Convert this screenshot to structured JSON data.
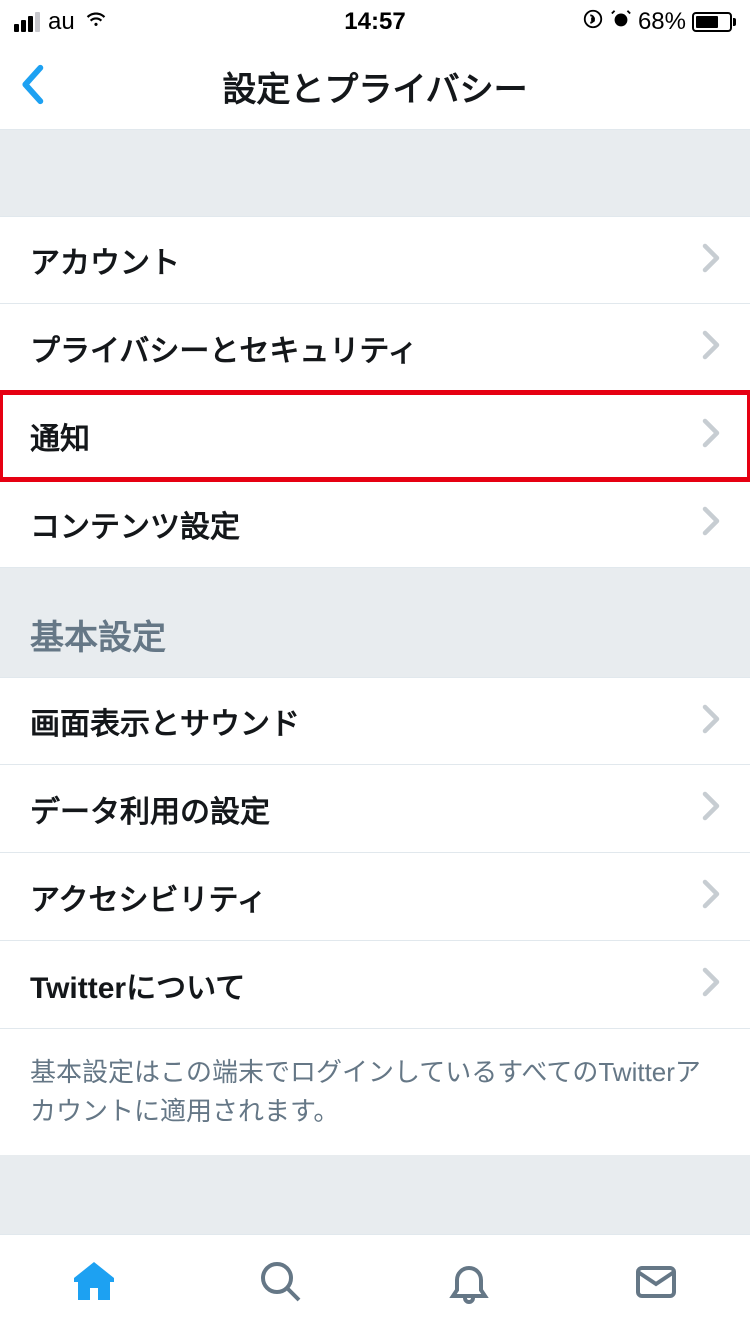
{
  "statusBar": {
    "carrier": "au",
    "time": "14:57",
    "batteryPercent": "68%"
  },
  "header": {
    "title": "設定とプライバシー"
  },
  "mainList": {
    "items": [
      {
        "label": "アカウント"
      },
      {
        "label": "プライバシーとセキュリティ"
      },
      {
        "label": "通知",
        "highlighted": true
      },
      {
        "label": "コンテンツ設定"
      }
    ]
  },
  "section": {
    "title": "基本設定",
    "items": [
      {
        "label": "画面表示とサウンド"
      },
      {
        "label": "データ利用の設定"
      },
      {
        "label": "アクセシビリティ"
      },
      {
        "label": "Twitterについて"
      }
    ],
    "footerNote": "基本設定はこの端末でログインしているすべてのTwitterアカウントに適用されます。"
  },
  "colors": {
    "accent": "#1da1f2",
    "highlight": "#e60012",
    "textPrimary": "#14171a",
    "textSecondary": "#657786",
    "background": "#e8ecef",
    "iconGray": "#657786"
  }
}
